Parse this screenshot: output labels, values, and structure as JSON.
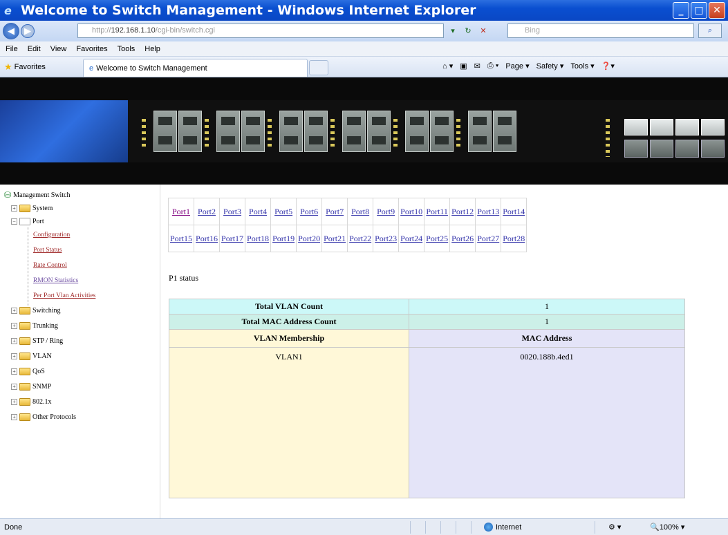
{
  "window": {
    "title": "Welcome to Switch Management - Windows Internet Explorer"
  },
  "address": {
    "prefix": "http://",
    "host": "192.168.1.10",
    "path": "/cgi-bin/switch.cgi"
  },
  "search": {
    "placeholder": "Bing"
  },
  "menu": [
    "File",
    "Edit",
    "View",
    "Favorites",
    "Tools",
    "Help"
  ],
  "favorites": {
    "label": "Favorites",
    "tab_title": "Welcome to Switch Management"
  },
  "commandbar": {
    "page": "Page",
    "safety": "Safety",
    "tools": "Tools"
  },
  "tree": {
    "root": "Management Switch",
    "items": [
      "System",
      "Port",
      "Switching",
      "Trunking",
      "STP / Ring",
      "VLAN",
      "QoS",
      "SNMP",
      "802.1x",
      "Other Protocols"
    ],
    "port_children": [
      "Configuration",
      "Port Status",
      "Rate Control",
      "RMON Statistics",
      "Per Port Vlan Activities"
    ]
  },
  "ports_row1": [
    "Port1",
    "Port2",
    "Port3",
    "Port4",
    "Port5",
    "Port6",
    "Port7",
    "Port8",
    "Port9",
    "Port10",
    "Port11",
    "Port12",
    "Port13",
    "Port14"
  ],
  "ports_row2": [
    "Port15",
    "Port16",
    "Port17",
    "Port18",
    "Port19",
    "Port20",
    "Port21",
    "Port22",
    "Port23",
    "Port24",
    "Port25",
    "Port26",
    "Port27",
    "Port28"
  ],
  "status": {
    "title": "P1 status",
    "total_vlan_label": "Total VLAN Count",
    "total_vlan_value": "1",
    "total_mac_label": "Total MAC Address Count",
    "total_mac_value": "1",
    "vlan_header": "VLAN Membership",
    "mac_header": "MAC Address",
    "vlan_value": "VLAN1",
    "mac_value": "0020.188b.4ed1"
  },
  "statusbar": {
    "left": "Done",
    "zone": "Internet",
    "zoom": "100%"
  },
  "colors": {
    "titlebar": "#0a4fd0",
    "link": "#3333aa",
    "visited": "#800080"
  }
}
